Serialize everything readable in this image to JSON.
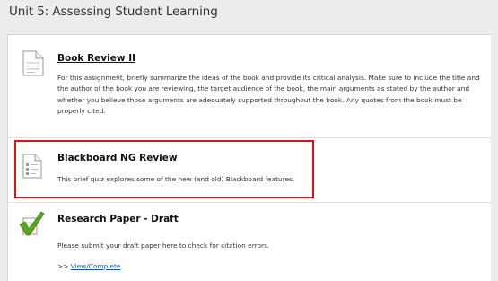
{
  "page": {
    "title": "Unit 5: Assessing Student Learning"
  },
  "items": [
    {
      "icon": "document-icon",
      "title": "Book Review II",
      "description": "For this assignment, briefly summarize the ideas of the book and provide its critical analysis. Make sure to include the title and the author of the book you are reviewing, the target audience of the book, the main arguments as stated by the author and whether you believe those arguments are adequately supported throughout the book. Any quotes from the book must be properly cited."
    },
    {
      "icon": "quiz-document-icon",
      "title": "Blackboard NG Review",
      "description": "This brief quiz explores some of the new (and old) Blackboard features.",
      "highlighted": true,
      "highlight_color": "#d4151b"
    },
    {
      "icon": "assignment-checkmark-icon",
      "title": "Research Paper - Draft",
      "description": "Please submit your draft paper here to check for citation errors.",
      "link_prefix": ">>",
      "link_label": "View/Complete"
    }
  ],
  "colors": {
    "background": "#ececec",
    "panel": "#ffffff",
    "link": "#1a53b8",
    "checkmark": "#5aa61e"
  }
}
